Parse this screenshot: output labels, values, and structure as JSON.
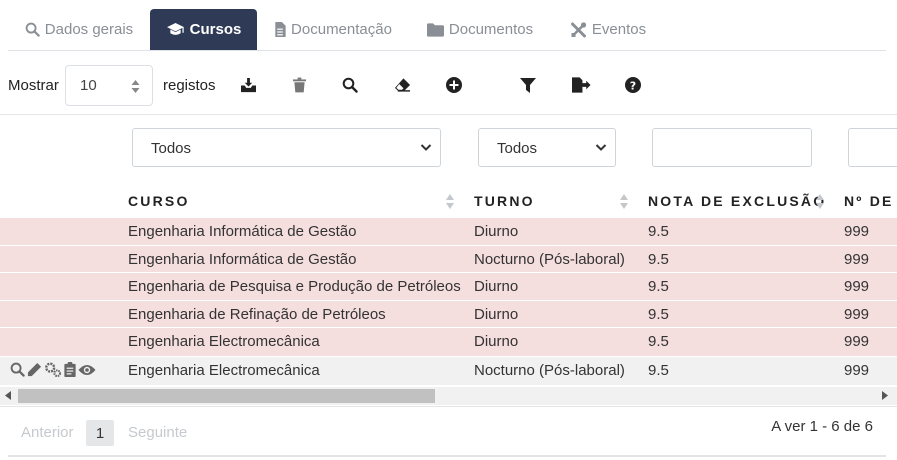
{
  "tabs": [
    {
      "label": "Dados gerais",
      "icon": "search-icon"
    },
    {
      "label": "Cursos",
      "icon": "graduation-cap-icon"
    },
    {
      "label": "Documentação",
      "icon": "file-icon"
    },
    {
      "label": "Documentos",
      "icon": "folder-icon"
    },
    {
      "label": "Eventos",
      "icon": "tools-icon"
    }
  ],
  "active_tab": "Cursos",
  "toolbar": {
    "show_label": "Mostrar",
    "page_length": "10",
    "records_label": "registos",
    "icons": [
      "inbox-download-icon",
      "trash-icon",
      "search-icon",
      "eraser-icon",
      "plus-circle-icon",
      "filter-icon",
      "export-icon",
      "help-icon"
    ]
  },
  "filters": {
    "curso": "Todos",
    "turno": "Todos",
    "nota": "",
    "numero": ""
  },
  "columns": [
    "CURSO",
    "TURNO",
    "NOTA DE EXCLUSÃO",
    "Nº DE"
  ],
  "rows": [
    {
      "curso": "Engenharia Informática de Gestão",
      "turno": "Diurno",
      "nota": "9.5",
      "numero": "999",
      "status": "highlighted"
    },
    {
      "curso": "Engenharia Informática de Gestão",
      "turno": "Nocturno (Pós-laboral)",
      "nota": "9.5",
      "numero": "999",
      "status": "highlighted"
    },
    {
      "curso": "Engenharia de Pesquisa e Produção de Petróleos",
      "turno": "Diurno",
      "nota": "9.5",
      "numero": "999",
      "status": "highlighted"
    },
    {
      "curso": "Engenharia de Refinação de Petróleos",
      "turno": "Diurno",
      "nota": "9.5",
      "numero": "999",
      "status": "highlighted"
    },
    {
      "curso": "Engenharia Electromecânica",
      "turno": "Diurno",
      "nota": "9.5",
      "numero": "999",
      "status": "highlighted"
    },
    {
      "curso": "Engenharia Electromecânica",
      "turno": "Nocturno (Pós-laboral)",
      "nota": "9.5",
      "numero": "999",
      "status": "hovered"
    }
  ],
  "row_actions": [
    "search-icon",
    "pencil-icon",
    "cogs-icon",
    "clipboard-icon",
    "eye-icon"
  ],
  "pagination": {
    "previous": "Anterior",
    "current_page": "1",
    "next": "Seguinte",
    "info": "A ver 1 - 6 de 6"
  },
  "colors": {
    "active_tab_bg": "#2e3a56",
    "highlight_row": "#f5dede",
    "hover_row": "#f1f1f2"
  }
}
